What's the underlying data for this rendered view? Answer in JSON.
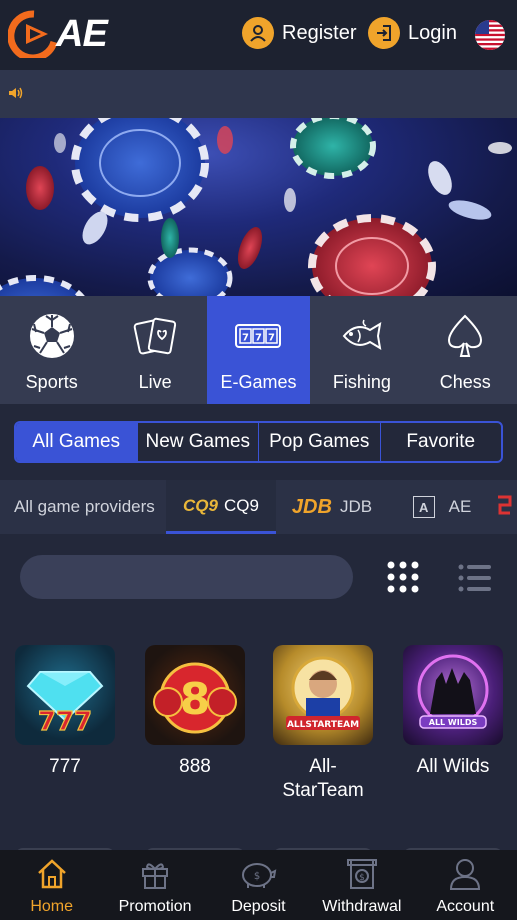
{
  "header": {
    "logo_text": "AE",
    "register_label": "Register",
    "login_label": "Login",
    "language": "English (US)"
  },
  "categories": [
    {
      "label": "Sports",
      "icon": "soccer-ball-icon"
    },
    {
      "label": "Live",
      "icon": "cards-icon"
    },
    {
      "label": "E-Games",
      "icon": "slot-777-icon",
      "active": true
    },
    {
      "label": "Fishing",
      "icon": "fish-icon"
    },
    {
      "label": "Chess",
      "icon": "spade-icon"
    }
  ],
  "filters": [
    {
      "label": "All Games",
      "active": true
    },
    {
      "label": "New Games"
    },
    {
      "label": "Pop Games"
    },
    {
      "label": "Favorite"
    }
  ],
  "providers": {
    "all_label": "All game providers",
    "items": [
      {
        "logo": "CQ9",
        "label": "CQ9",
        "active": true
      },
      {
        "logo": "JDB",
        "label": "JDB"
      },
      {
        "logo": "A",
        "label": "AE"
      }
    ]
  },
  "search": {
    "placeholder": ""
  },
  "games": [
    {
      "name": "777"
    },
    {
      "name": "888"
    },
    {
      "name": "All-\nStarTeam"
    },
    {
      "name": "All Wilds"
    }
  ],
  "bottom_nav": [
    {
      "label": "Home",
      "icon": "home-icon",
      "active": true
    },
    {
      "label": "Promotion",
      "icon": "gift-icon"
    },
    {
      "label": "Deposit",
      "icon": "piggy-bank-icon"
    },
    {
      "label": "Withdrawal",
      "icon": "atm-icon"
    },
    {
      "label": "Account",
      "icon": "user-icon"
    }
  ],
  "colors": {
    "accent": "#3a53d6",
    "gold": "#f0a42b",
    "background": "#23283a"
  }
}
